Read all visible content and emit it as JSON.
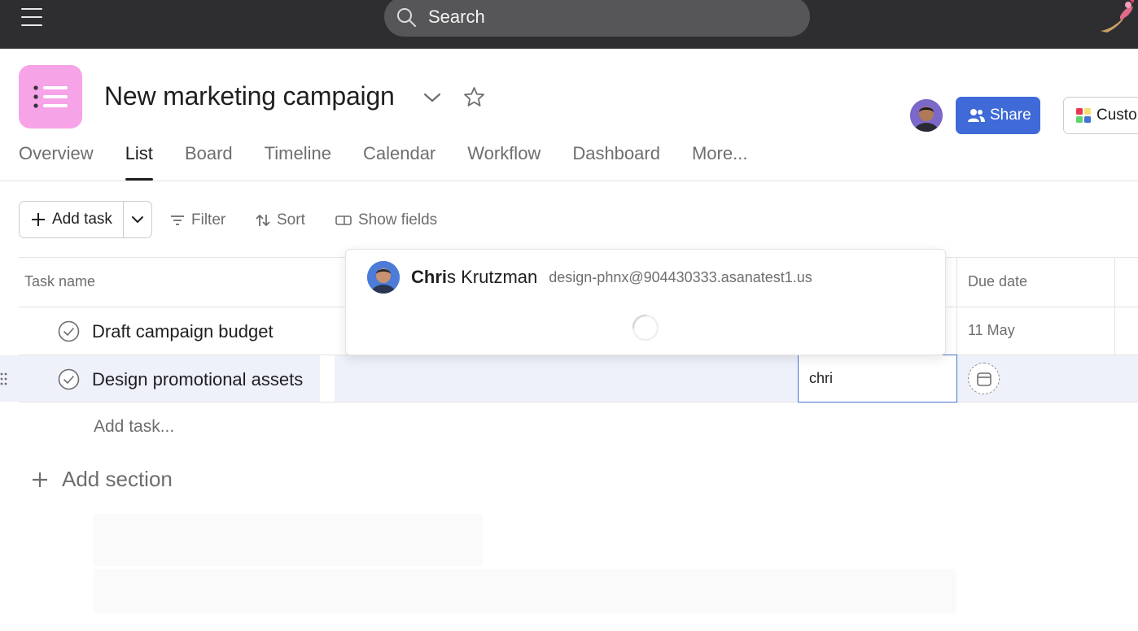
{
  "topbar": {
    "search_placeholder": "Search"
  },
  "project": {
    "title": "New marketing campaign",
    "icon_color": "#f6a3e8"
  },
  "header_actions": {
    "share_label": "Share",
    "customize_label": "Custo"
  },
  "tabs": [
    {
      "label": "Overview"
    },
    {
      "label": "List"
    },
    {
      "label": "Board"
    },
    {
      "label": "Timeline"
    },
    {
      "label": "Calendar"
    },
    {
      "label": "Workflow"
    },
    {
      "label": "Dashboard"
    },
    {
      "label": "More..."
    }
  ],
  "active_tab": "List",
  "toolbar": {
    "add_task_label": "Add task",
    "filter_label": "Filter",
    "sort_label": "Sort",
    "show_fields_label": "Show fields"
  },
  "table": {
    "columns": {
      "task_name": "Task name",
      "due_date": "Due date"
    },
    "rows": [
      {
        "name": "Draft campaign budget",
        "due": "11 May"
      },
      {
        "name": "Design promotional assets",
        "due": ""
      }
    ],
    "assignee_input_value": "chri",
    "add_task_placeholder": "Add task...",
    "add_section_label": "Add section"
  },
  "assignee_dropdown": {
    "match_bold": "Chri",
    "match_rest": "s Krutzman",
    "email": "design-phnx@904430333.asanatest1.us"
  },
  "colors": {
    "topbar_bg": "#2e2e30",
    "share_button": "#3f6ad8",
    "input_focus_border": "#4573d2",
    "row_highlight": "#eef0fa"
  }
}
